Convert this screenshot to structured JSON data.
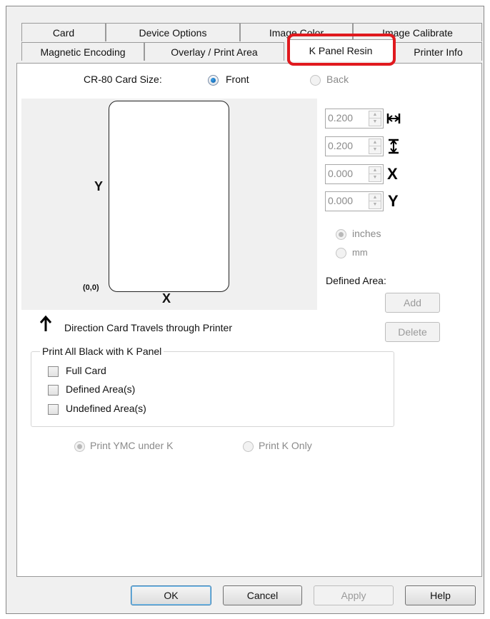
{
  "tabs_row1": [
    "Card",
    "Device Options",
    "Image Color",
    "Image Calibrate"
  ],
  "tabs_row2": [
    "Magnetic Encoding",
    "Overlay / Print Area",
    "K Panel Resin",
    "Printer Info"
  ],
  "active_tab": "K Panel Resin",
  "highlight_color": "#e0191e",
  "card_size": {
    "label": "CR-80 Card Size:",
    "front_label": "Front",
    "back_label": "Back",
    "selected": "Front"
  },
  "preview": {
    "y_axis": "Y",
    "x_axis": "X",
    "origin": "(0,0)",
    "direction_text": "Direction Card Travels through Printer",
    "direction_icon": "up-arrow-icon"
  },
  "dimensions": [
    {
      "value": "0.200",
      "icon": "width-icon"
    },
    {
      "value": "0.200",
      "icon": "height-icon"
    },
    {
      "value": "0.000",
      "icon": "X"
    },
    {
      "value": "0.000",
      "icon": "Y"
    }
  ],
  "units": {
    "inches_label": "inches",
    "mm_label": "mm",
    "selected": "inches"
  },
  "defined_area": {
    "label": "Defined Area:",
    "add_label": "Add",
    "delete_label": "Delete"
  },
  "black_group": {
    "legend": "Print All Black with K Panel",
    "options": [
      "Full Card",
      "Defined Area(s)",
      "Undefined Area(s)"
    ]
  },
  "print_mode": {
    "option1": "Print YMC under K",
    "option2": "Print K Only",
    "selected": "Print YMC under K"
  },
  "buttons": {
    "ok": "OK",
    "cancel": "Cancel",
    "apply": "Apply",
    "help": "Help"
  }
}
